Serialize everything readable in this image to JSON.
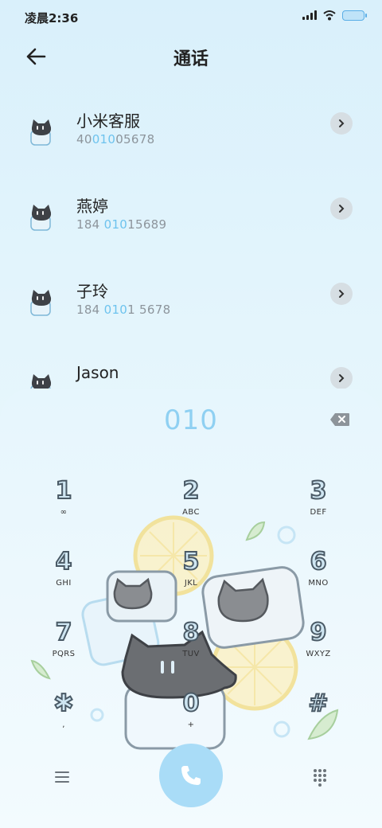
{
  "status_bar": {
    "time": "凌晨2:36"
  },
  "header": {
    "title": "通话"
  },
  "contacts": [
    {
      "name": "小米客服",
      "number_parts": [
        "40",
        "010",
        "05678"
      ]
    },
    {
      "name": "燕婷",
      "number_parts": [
        "184 ",
        "010",
        "15689"
      ]
    },
    {
      "name": "子玲",
      "number_parts": [
        "184 ",
        "010",
        "1 5678"
      ]
    },
    {
      "name": "Jason",
      "number_parts": [
        "",
        "",
        ""
      ]
    }
  ],
  "dialer": {
    "dialed": "010",
    "keys": [
      {
        "digit": "1",
        "letters": "∞"
      },
      {
        "digit": "2",
        "letters": "ABC"
      },
      {
        "digit": "3",
        "letters": "DEF"
      },
      {
        "digit": "4",
        "letters": "GHI"
      },
      {
        "digit": "5",
        "letters": "JKL"
      },
      {
        "digit": "6",
        "letters": "MNO"
      },
      {
        "digit": "7",
        "letters": "PQRS"
      },
      {
        "digit": "8",
        "letters": "TUV"
      },
      {
        "digit": "9",
        "letters": "WXYZ"
      },
      {
        "digit": "✱",
        "letters": ","
      },
      {
        "digit": "0",
        "letters": "+"
      },
      {
        "digit": "#",
        "letters": ""
      }
    ]
  },
  "colors": {
    "accent": "#8fd0f2",
    "highlight": "#6ec3ee",
    "call_button": "#a9dcf7"
  }
}
